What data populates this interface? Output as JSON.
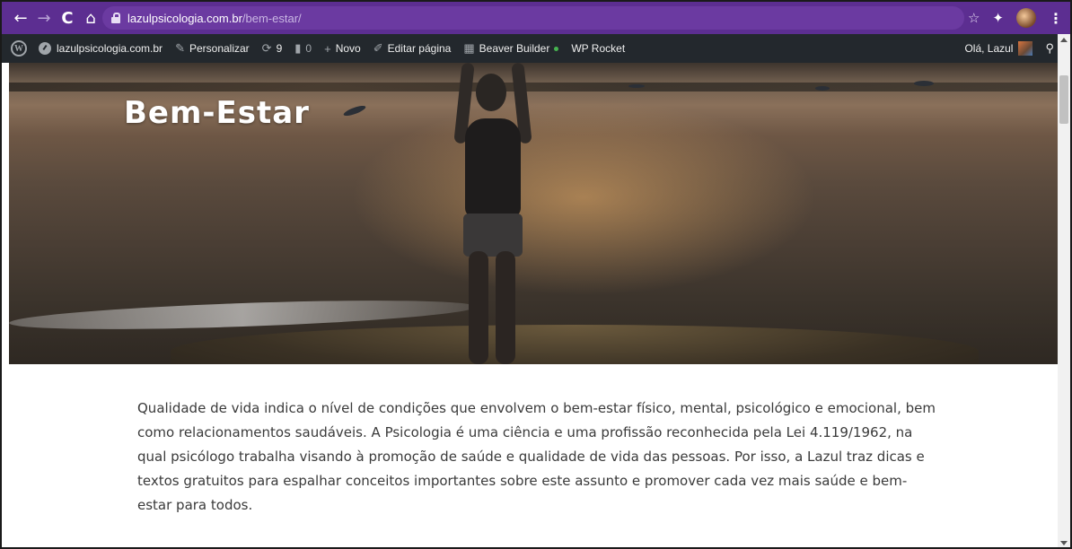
{
  "browser": {
    "url_domain": "lazulpsicologia.com.br",
    "url_path": "/bem-estar/",
    "icons": [
      "back-arrow-icon",
      "forward-arrow-icon",
      "reload-icon",
      "home-icon",
      "lock-icon",
      "star-icon",
      "puzzle-icon",
      "profile-icon",
      "kebab-menu-icon"
    ],
    "back_glyph": "←",
    "forward_glyph": "→",
    "reload_glyph": "C",
    "home_glyph": "⌂",
    "star_glyph": "☆",
    "puzzle_glyph": "✦",
    "menu_glyph": "⋮"
  },
  "admin_bar": {
    "wp_logo": "W",
    "site_name": "lazulpsicologia.com.br",
    "customize": "Personalizar",
    "updates_count": "9",
    "comments_count": "0",
    "new": "Novo",
    "edit_page": "Editar página",
    "beaver_builder": "Beaver Builder",
    "wp_rocket": "WP Rocket",
    "greeting": "Olá, Lazul",
    "colors": {
      "background": "#23282d",
      "status_dot": "#46b450"
    }
  },
  "hero": {
    "title": "Bem-Estar"
  },
  "content": {
    "paragraph": "Qualidade de vida indica o nível de condições que envolvem o bem-estar físico, mental, psicológico e emocional, bem como relacionamentos saudáveis. A Psicologia é uma ciência e uma profissão reconhecida pela Lei 4.119/1962, na qual psicólogo trabalha visando à promoção de saúde e qualidade de vida das pessoas. Por isso, a Lazul traz dicas e textos gratuitos para espalhar conceitos importantes sobre este assunto e promover cada vez mais saúde e bem-estar para todos."
  },
  "theme": {
    "browser_bar": "#5c2e91",
    "text": "#3a3a3a"
  }
}
